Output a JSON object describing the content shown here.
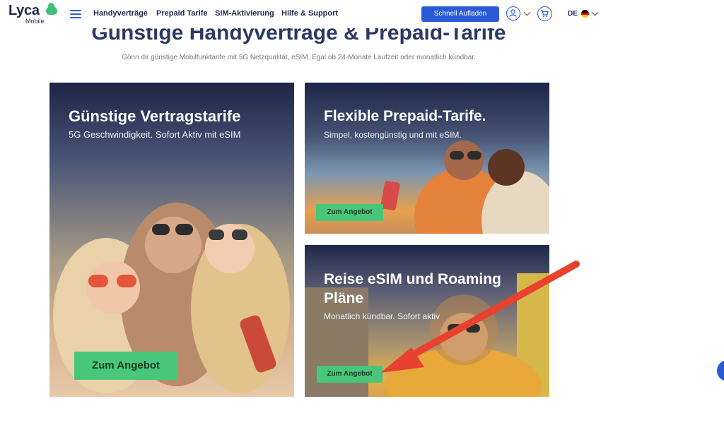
{
  "header": {
    "logo_text": "Lyca",
    "logo_sub": "Mobile",
    "nav": [
      "Handyverträge",
      "Prepaid Tarife",
      "SIM-Aktivierung",
      "Hilfe & Support"
    ],
    "cta_label": "Schnell Aufladen",
    "language": "DE"
  },
  "hero": {
    "title": "Günstige Handyverträge & Prepaid-Tarife",
    "subtitle": "Gönn dir günstige Mobilfunktarife mit 5G Netzqualität, eSIM. Egal ob 24-Monate Laufzeit oder monatlich kündbar."
  },
  "cards": [
    {
      "title": "Günstige Vertragstarife",
      "subtitle": "5G Geschwindigkeit. Sofort Aktiv mit eSIM",
      "button": "Zum Angebot"
    },
    {
      "title": "Flexible Prepaid-Tarife.",
      "subtitle": "Simpel, kostengünstig und mit eSIM.",
      "button": "Zum Angebot"
    },
    {
      "title": "Reise eSIM und Roaming Pläne",
      "subtitle": "Monatlich kündbar. Sofort aktiv",
      "button": "Zum Angebot"
    }
  ],
  "colors": {
    "brand": "#2a5bd7",
    "accent_green": "#48c77a",
    "annotation_arrow": "#e8412e"
  }
}
